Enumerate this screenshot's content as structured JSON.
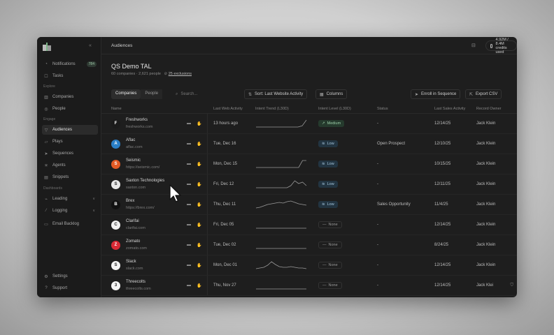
{
  "app": {
    "breadcrumb": "Audiences",
    "credits": "4.92M / 8.4M credits used"
  },
  "sidebar": {
    "items": [
      {
        "label": "Notifications",
        "badge": "784",
        "icon": "bell-icon"
      },
      {
        "label": "Tasks",
        "icon": "check-icon"
      },
      {
        "label": "Companies",
        "icon": "building-icon"
      },
      {
        "label": "People",
        "icon": "people-icon"
      },
      {
        "label": "Audiences",
        "icon": "filter-icon"
      },
      {
        "label": "Plays",
        "icon": "play-icon"
      },
      {
        "label": "Sequences",
        "icon": "send-icon"
      },
      {
        "label": "Agents",
        "icon": "agent-icon"
      },
      {
        "label": "Snippets",
        "icon": "snippet-icon"
      },
      {
        "label": "Leading",
        "icon": "lead-icon"
      },
      {
        "label": "Logging",
        "icon": "log-icon"
      },
      {
        "label": "Email Backlog",
        "icon": "mail-icon"
      },
      {
        "label": "Settings",
        "icon": "gear-icon"
      },
      {
        "label": "Support",
        "icon": "help-icon"
      }
    ],
    "sections": [
      "Explore",
      "Engage",
      "Dashboards"
    ]
  },
  "page": {
    "title": "QS Demo TAL",
    "stats": "60 companies · 2,621 people",
    "exclusions": "25 exclusions"
  },
  "toolbar": {
    "tab_companies": "Companies",
    "tab_people": "People",
    "search_placeholder": "Search...",
    "sort_label": "Sort: Last Website Activity",
    "columns_label": "Columns",
    "enroll_label": "Enroll in Sequence",
    "export_label": "Export CSV"
  },
  "table": {
    "headers": [
      "Name",
      "Last Web Activity",
      "Intent Trend (L30D)",
      "Intent Level (L30D)",
      "Status",
      "Last Sales Activity",
      "Record Owner"
    ],
    "rows": [
      {
        "name": "Freshworks",
        "url": "freshworks.com",
        "last_web": "13 hours ago",
        "intent": "Medium",
        "intent_kind": "med",
        "status": "-",
        "last_sales": "12/14/25",
        "owner": "Jack Klein",
        "logo_bg": "#1b1b1b",
        "logo_text": "F",
        "trend": [
          0,
          0,
          0,
          0,
          0,
          0,
          0,
          0,
          0,
          0,
          0,
          1,
          6
        ]
      },
      {
        "name": "Aflac",
        "url": "aflac.com",
        "last_web": "Tue, Dec 16",
        "intent": "Low",
        "intent_kind": "low",
        "status": "Open Prospect",
        "last_sales": "12/10/25",
        "owner": "Jack Klein",
        "logo_bg": "#2a7fc7",
        "logo_text": "A",
        "trend": []
      },
      {
        "name": "Seismic",
        "url": "https://seismic.com/",
        "last_web": "Mon, Dec 15",
        "intent": "Low",
        "intent_kind": "low",
        "status": "-",
        "last_sales": "10/15/25",
        "owner": "Jack Klein",
        "logo_bg": "#e25a24",
        "logo_text": "S",
        "trend": [
          0,
          0,
          0,
          0,
          0,
          0,
          0,
          0,
          0,
          0,
          0,
          0,
          1,
          1
        ]
      },
      {
        "name": "Saxton Technologies",
        "url": "saxton.com",
        "last_web": "Fri, Dec 12",
        "intent": "Low",
        "intent_kind": "low",
        "status": "-",
        "last_sales": "12/11/25",
        "owner": "Jack Klein",
        "logo_bg": "#e8e8e8",
        "logo_text": "S",
        "trend": [
          0,
          0,
          0,
          0,
          0,
          0,
          0,
          0,
          0,
          0.3,
          1,
          0.6,
          0.8,
          0.3
        ]
      },
      {
        "name": "Brex",
        "url": "https://brex.com/",
        "last_web": "Thu, Dec 11",
        "intent": "Low",
        "intent_kind": "low",
        "status": "Sales Opportunity",
        "last_sales": "11/4/25",
        "owner": "Jack Klein",
        "logo_bg": "#111111",
        "logo_text": "B",
        "trend": [
          0,
          0.1,
          0.3,
          0.5,
          0.6,
          0.7,
          0.8,
          0.7,
          0.9,
          1,
          0.8,
          0.6,
          0.5,
          0.4
        ]
      },
      {
        "name": "Clarifai",
        "url": "clarifai.com",
        "last_web": "Fri, Dec 05",
        "intent": "None",
        "intent_kind": "none",
        "status": "-",
        "last_sales": "12/14/25",
        "owner": "Jack Klein",
        "logo_bg": "#f2f2f2",
        "logo_text": "C",
        "trend": [
          0,
          0,
          0,
          0,
          0,
          0,
          0,
          0,
          0,
          0,
          0,
          0,
          0,
          0
        ]
      },
      {
        "name": "Zomato",
        "url": "zomato.com",
        "last_web": "Tue, Dec 02",
        "intent": "None",
        "intent_kind": "none",
        "status": "-",
        "last_sales": "8/24/25",
        "owner": "Jack Klein",
        "logo_bg": "#d92a35",
        "logo_text": "Z",
        "trend": [
          0,
          0,
          0,
          0,
          0,
          0,
          0,
          0,
          0,
          0,
          0,
          0,
          0,
          0
        ]
      },
      {
        "name": "Slack",
        "url": "slack.com",
        "last_web": "Mon, Dec 01",
        "intent": "None",
        "intent_kind": "none",
        "status": "-",
        "last_sales": "12/14/25",
        "owner": "Jack Klein",
        "logo_bg": "#f4f4f4",
        "logo_text": "S",
        "trend": [
          0,
          0.1,
          0.2,
          0.5,
          1,
          0.6,
          0.3,
          0.2,
          0.2,
          0.3,
          0.2,
          0.1,
          0.1,
          0
        ]
      },
      {
        "name": "Threecolts",
        "url": "threecolts.com",
        "last_web": "Thu, Nov 27",
        "intent": "None",
        "intent_kind": "none",
        "status": "-",
        "last_sales": "12/14/25",
        "owner": "Jack Klei",
        "logo_bg": "#f4f4f4",
        "logo_text": "3",
        "trend": [
          0,
          0,
          0,
          0,
          0,
          0,
          0,
          0,
          0,
          0,
          0,
          0,
          0,
          0
        ]
      }
    ]
  },
  "colors": {
    "background": "#1e1e1e",
    "accent_low": "#223441",
    "accent_medium": "#253a2d"
  }
}
